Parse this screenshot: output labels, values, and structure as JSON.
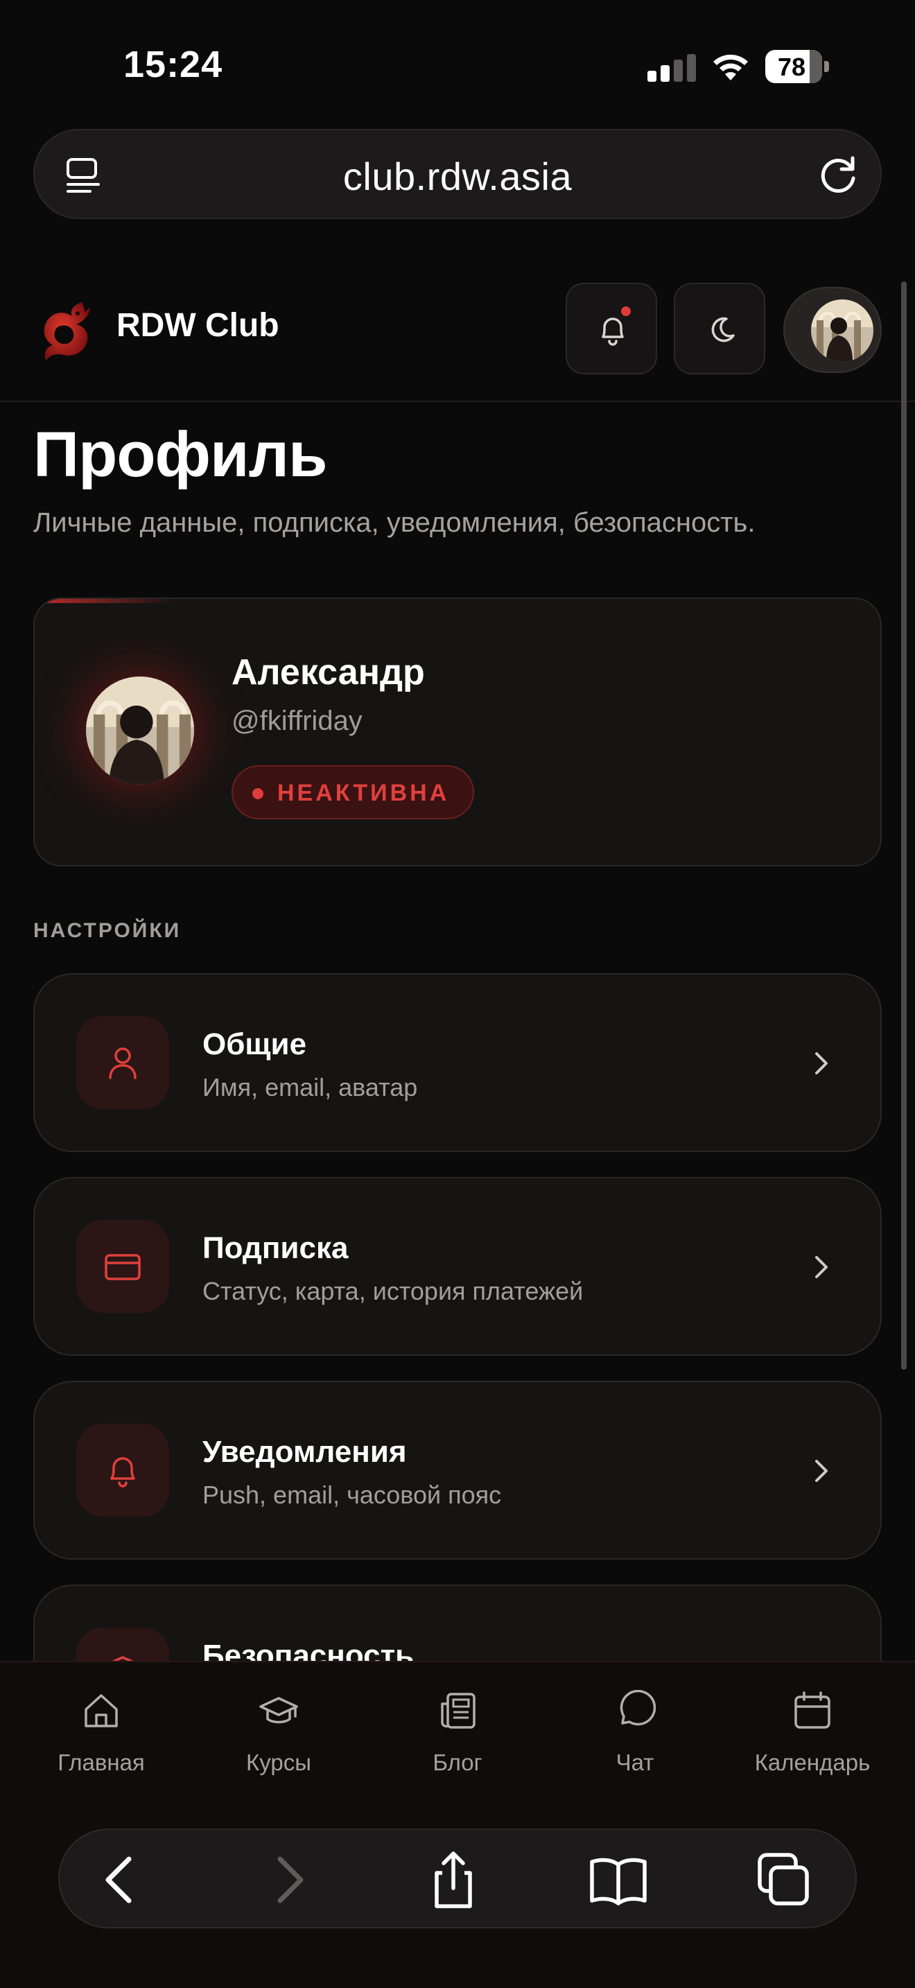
{
  "status_bar": {
    "time": "15:24",
    "battery": "78"
  },
  "browser": {
    "url": "club.rdw.asia"
  },
  "header": {
    "brand": "RDW Club"
  },
  "page": {
    "title": "Профиль",
    "subtitle": "Личные данные, подписка, уведомления, безопасность."
  },
  "profile": {
    "name": "Александр",
    "handle": "@fkiffriday",
    "status": "НЕАКТИВНА"
  },
  "settings": {
    "section_label": "НАСТРОЙКИ",
    "items": [
      {
        "title": "Общие",
        "description": "Имя, email, аватар",
        "icon": "user-icon"
      },
      {
        "title": "Подписка",
        "description": "Статус, карта, история платежей",
        "icon": "credit-card-icon"
      },
      {
        "title": "Уведомления",
        "description": "Push, email, часовой пояс",
        "icon": "bell-icon"
      },
      {
        "title": "Безопасность",
        "description": "",
        "icon": "shield-icon"
      }
    ]
  },
  "bottom_nav": [
    {
      "label": "Главная",
      "icon": "home-icon"
    },
    {
      "label": "Курсы",
      "icon": "graduation-cap-icon"
    },
    {
      "label": "Блог",
      "icon": "newspaper-icon"
    },
    {
      "label": "Чат",
      "icon": "chat-bubble-icon"
    },
    {
      "label": "Календарь",
      "icon": "calendar-icon"
    }
  ],
  "colors": {
    "background": "#0b0a0a",
    "card": "#161413",
    "accent": "#e0403d",
    "text_muted": "#a39e9b"
  }
}
